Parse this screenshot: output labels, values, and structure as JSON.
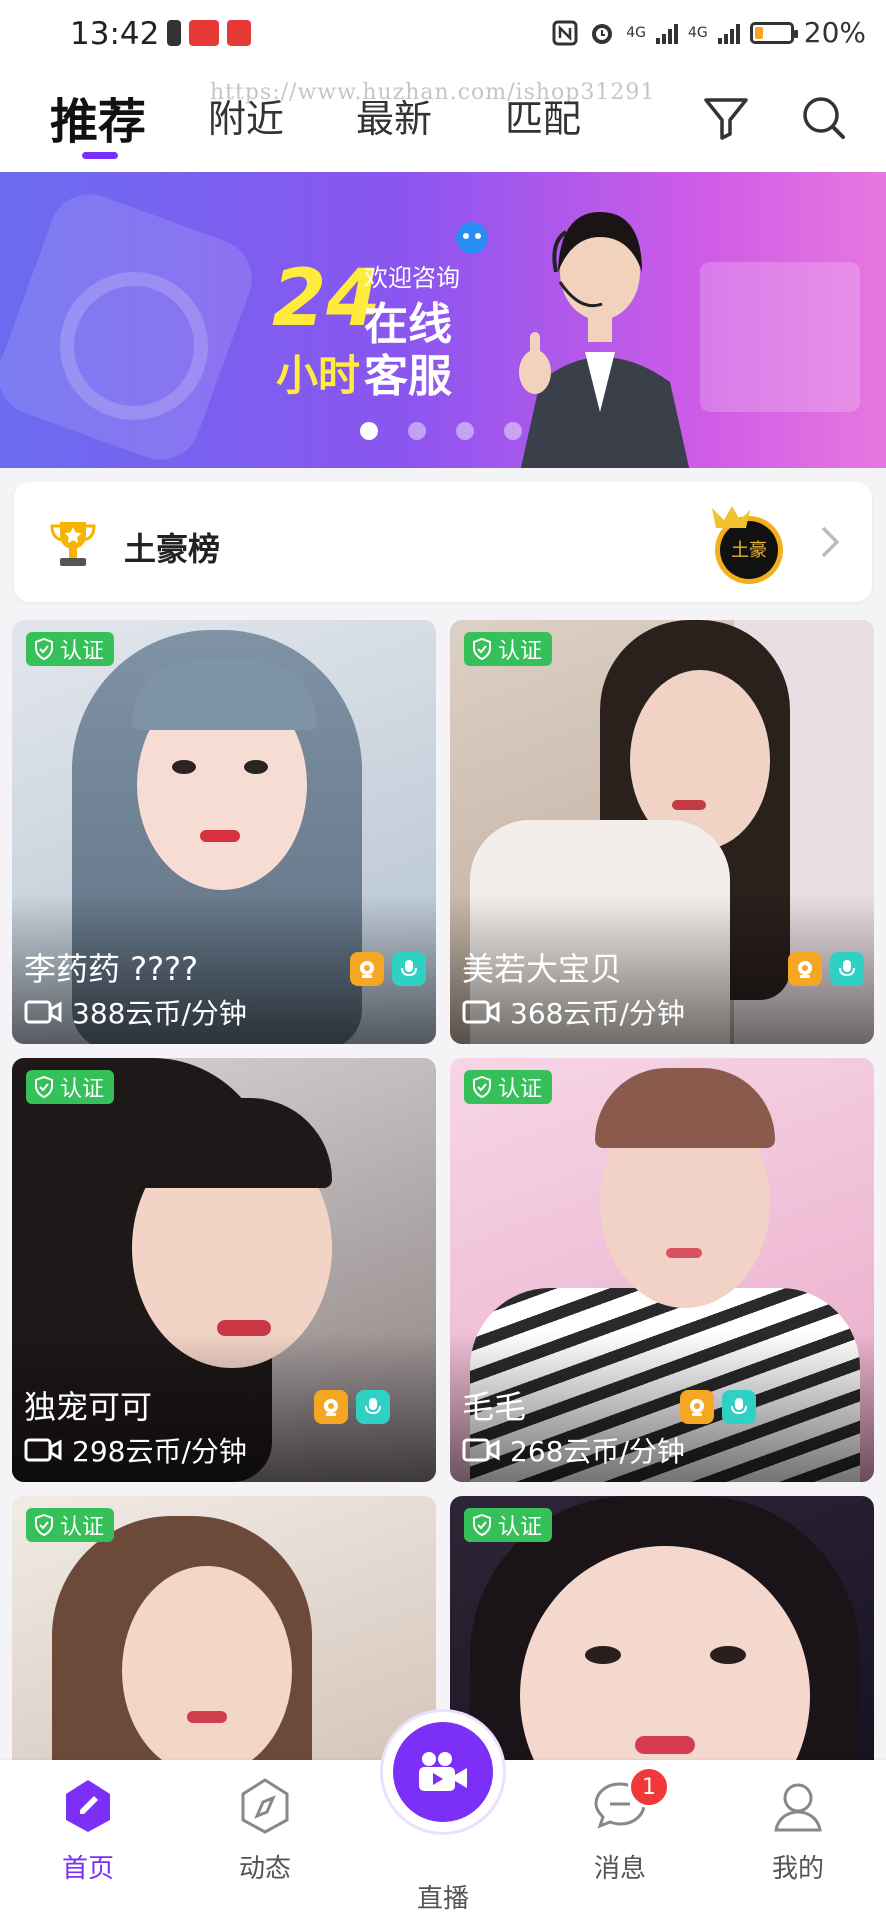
{
  "status_bar": {
    "time": "13:42",
    "network_1": "4G",
    "network_2": "4G",
    "battery": "20%"
  },
  "watermark": "https://www.huzhan.com/ishop31291",
  "tabs": [
    {
      "label": "推荐",
      "active": true
    },
    {
      "label": "附近",
      "active": false
    },
    {
      "label": "最新",
      "active": false
    },
    {
      "label": "匹配",
      "active": false
    }
  ],
  "banner": {
    "big_number": "24",
    "hours": "小时",
    "welcome": "欢迎咨询",
    "online": "在线",
    "service": "客服",
    "dots": 4,
    "active_dot": 1
  },
  "rich_list": {
    "label": "土豪榜",
    "avatar_text": "土豪"
  },
  "cards": [
    {
      "name": "李药药 ????",
      "price": "388云币/分钟",
      "badge": "认证",
      "colors": [
        "#d9dfe6",
        "#9fb3c7"
      ]
    },
    {
      "name": "美若大宝贝",
      "price": "368云币/分钟",
      "badge": "认证",
      "colors": [
        "#d8c6b7",
        "#8e7a6c"
      ]
    },
    {
      "name": "独宠可可",
      "price": "298云币/分钟",
      "badge": "认证",
      "colors": [
        "#d3cfcf",
        "#6e6262"
      ]
    },
    {
      "name": "毛毛",
      "price": "268云币/分钟",
      "badge": "认证",
      "colors": [
        "#f4cde0",
        "#e6a8c7"
      ]
    },
    {
      "name": "",
      "price": "",
      "badge": "认证",
      "colors": [
        "#e6ddd6",
        "#b49f90"
      ]
    },
    {
      "name": "",
      "price": "",
      "badge": "认证",
      "colors": [
        "#3a2f45",
        "#0f0b16"
      ]
    }
  ],
  "bottom_nav": [
    {
      "label": "首页",
      "icon": "home-icon",
      "active": true
    },
    {
      "label": "动态",
      "icon": "compass-icon",
      "active": false
    },
    {
      "label": "直播",
      "icon": "video-camera-icon",
      "active": false
    },
    {
      "label": "消息",
      "icon": "message-icon",
      "active": false,
      "badge": "1"
    },
    {
      "label": "我的",
      "icon": "profile-icon",
      "active": false
    }
  ],
  "colors": {
    "accent": "#7b2ff7",
    "verified_green": "#35c05a",
    "badge_red": "#f2373b"
  }
}
